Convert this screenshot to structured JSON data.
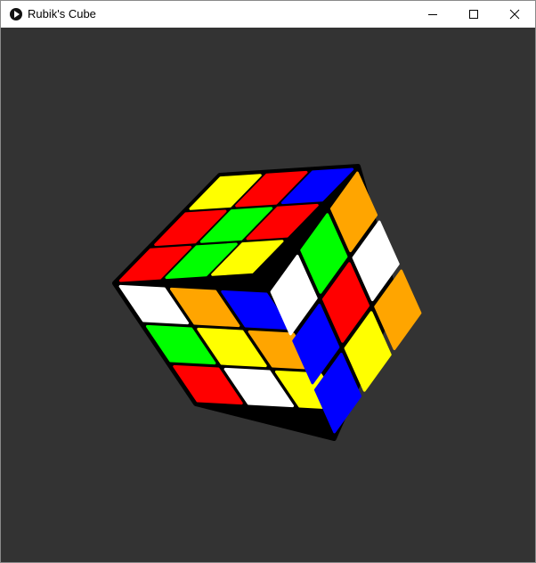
{
  "window": {
    "title": "Rubik's Cube",
    "app_icon": "play-circle-icon",
    "controls": [
      "minimize-icon",
      "maximize-icon",
      "close-icon"
    ]
  },
  "scene": {
    "background": "#333333",
    "cube": {
      "border_color": "#000000",
      "faces": {
        "top": {
          "rows": [
            [
              "red",
              "green",
              "yellow"
            ],
            [
              "red",
              "green",
              "red"
            ],
            [
              "yellow",
              "red",
              "blue"
            ]
          ]
        },
        "left": {
          "rows": [
            [
              "white",
              "orange",
              "blue"
            ],
            [
              "green",
              "yellow",
              "orange"
            ],
            [
              "red",
              "white",
              "yellow"
            ]
          ]
        },
        "right": {
          "rows": [
            [
              "white",
              "green",
              "orange"
            ],
            [
              "blue",
              "red",
              "white"
            ],
            [
              "blue",
              "yellow",
              "orange"
            ]
          ]
        }
      },
      "palette": {
        "red": "#ff0000",
        "green": "#00ff00",
        "blue": "#0000ff",
        "yellow": "#ffff00",
        "orange": "#ffa500",
        "white": "#ffffff"
      }
    }
  }
}
